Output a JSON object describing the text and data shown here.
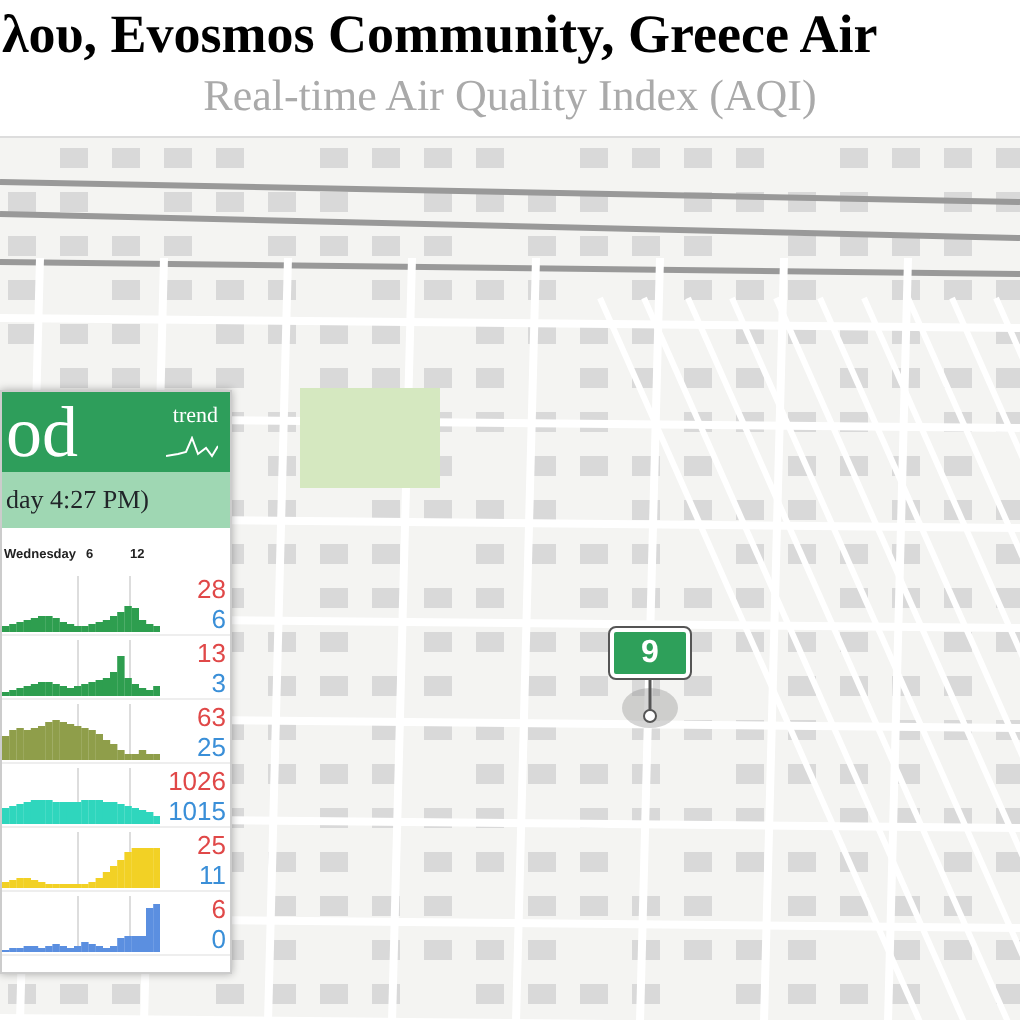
{
  "title": "λου, Evosmos Community, Greece Air",
  "subtitle": "Real-time Air Quality Index (AQI)",
  "panel": {
    "rating": "od",
    "trend_label": "trend",
    "updated": "day 4:27 PM)",
    "axis_labels": [
      "Wednesday",
      "6",
      "12"
    ],
    "rows": [
      {
        "max": "28",
        "min": "6",
        "color": "#2e9e4f"
      },
      {
        "max": "13",
        "min": "3",
        "color": "#2e9e4f"
      },
      {
        "max": "63",
        "min": "25",
        "color": "#8f9e4a"
      },
      {
        "max": "1026",
        "min": "1015",
        "color": "#2fd6bd"
      },
      {
        "max": "25",
        "min": "11",
        "color": "#f2d125"
      },
      {
        "max": "6",
        "min": "0",
        "color": "#5b8fe0"
      }
    ]
  },
  "marker": {
    "value": "9"
  }
}
